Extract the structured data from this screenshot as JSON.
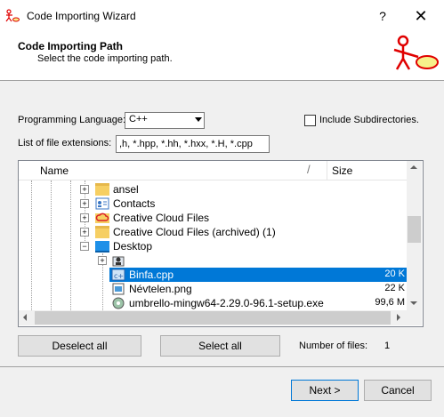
{
  "window": {
    "title": "Code Importing Wizard",
    "help_label": "?",
    "close_label": "✕"
  },
  "header": {
    "title": "Code Importing Path",
    "subtitle": "Select the code importing path."
  },
  "form": {
    "language_label": "Programming Language:",
    "language_value": "C++",
    "include_subdirs_label": "Include Subdirectories.",
    "include_subdirs_checked": false,
    "extensions_label": "List of file extensions:",
    "extensions_value": ",h, *.hpp, *.hh, *.hxx, *.H, *.cpp"
  },
  "tree": {
    "columns": {
      "name": "Name",
      "size": "Size",
      "sort_glyph": "/"
    },
    "rows": [
      {
        "label": "ansel",
        "icon": "folder-icon",
        "expander": "+",
        "size": ""
      },
      {
        "label": "Contacts",
        "icon": "contacts-icon",
        "expander": "+",
        "size": ""
      },
      {
        "label": "Creative Cloud Files",
        "icon": "creative-cloud-icon",
        "expander": "+",
        "size": ""
      },
      {
        "label": "Creative Cloud Files (archived) (1)",
        "icon": "folder-icon",
        "expander": "+",
        "size": ""
      },
      {
        "label": "Desktop",
        "icon": "desktop-folder-icon",
        "expander": "−",
        "size": ""
      },
      {
        "label": "",
        "icon": "git-folder-icon",
        "expander": "+",
        "size": ""
      },
      {
        "label": "Binfa.cpp",
        "icon": "cpp-file-icon",
        "expander": "",
        "size": "20 K",
        "selected": true
      },
      {
        "label": "Névtelen.png",
        "icon": "image-file-icon",
        "expander": "",
        "size": "22 K"
      },
      {
        "label": "umbrello-mingw64-2.29.0-96.1-setup.exe",
        "icon": "installer-icon",
        "expander": "",
        "size": "99,6 M"
      }
    ]
  },
  "actions": {
    "deselect_all": "Deselect all",
    "select_all": "Select all",
    "num_files_label": "Number of files:",
    "num_files_value": "1"
  },
  "footer": {
    "next": "Next >",
    "cancel": "Cancel"
  },
  "colors": {
    "selection": "#0078d7",
    "logo": "#e00000",
    "logo_fill": "#f6f08a"
  }
}
